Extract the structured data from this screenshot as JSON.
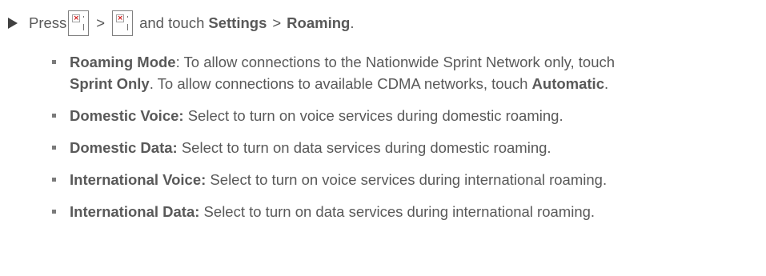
{
  "step": {
    "press": "Press",
    "gt1": ">",
    "and_touch": "and touch",
    "settings": "Settings",
    "gt2": ">",
    "roaming": "Roaming",
    "period": "."
  },
  "items": [
    {
      "term": "Roaming Mode",
      "after_term": ": To allow connections to the Nationwide Sprint Network only, touch",
      "opt1": "Sprint Only",
      "mid": ". To allow connections to available CDMA networks, touch",
      "opt2": "Automatic",
      "end": "."
    },
    {
      "term": "Domestic Voice:",
      "text": " Select to turn on voice services during domestic roaming."
    },
    {
      "term": "Domestic Data:",
      "text": " Select to turn on data services during domestic roaming."
    },
    {
      "term": "International Voice:",
      "text": " Select to turn on voice services during international roaming."
    },
    {
      "term": "International Data:",
      "text": " Select to turn on data services during international roaming."
    }
  ]
}
